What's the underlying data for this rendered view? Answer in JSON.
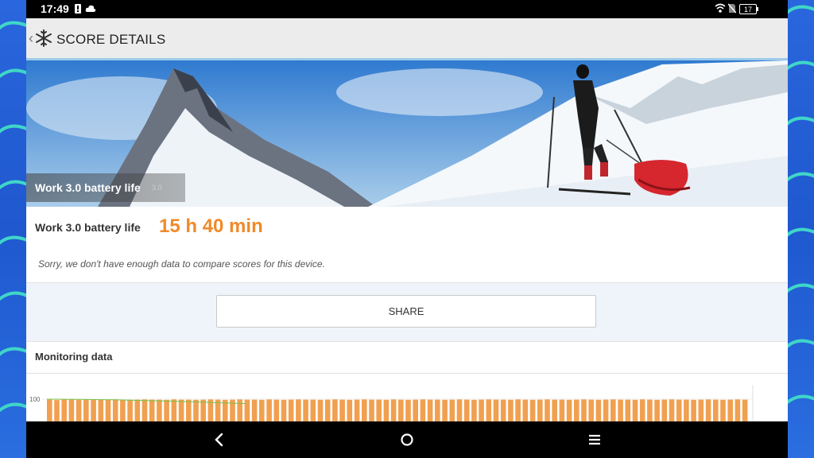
{
  "status_bar": {
    "time": "17:49",
    "battery_level": "17",
    "icons": [
      "notification-icon",
      "cloud-icon",
      "wifi-icon",
      "no-sim-icon",
      "battery-icon"
    ]
  },
  "app_bar": {
    "title": "SCORE DETAILS",
    "back_icon": "chevron-left-icon",
    "app_icon": "snowflake-icon"
  },
  "banner": {
    "caption_title": "Work 3.0 battery life",
    "caption_version": "3.0"
  },
  "score": {
    "label": "Work 3.0 battery life",
    "value": "15 h 40 min"
  },
  "notice": "Sorry, we don't have enough data to compare scores for this device.",
  "share_label": "SHARE",
  "monitoring": {
    "title": "Monitoring data",
    "y_tick": "100"
  },
  "chart_data": {
    "type": "bar",
    "y_tick_labels": [
      "100"
    ],
    "bar_series_values": [
      98,
      96,
      98,
      99,
      97,
      98,
      99,
      98,
      97,
      99,
      98,
      97,
      98,
      99,
      98,
      98,
      97,
      99,
      98,
      98,
      97,
      98,
      99,
      98,
      97,
      98,
      99,
      98,
      98,
      97,
      99,
      98,
      97,
      98,
      99,
      98,
      98,
      97,
      98,
      99,
      98,
      97,
      98,
      99,
      98,
      98,
      97,
      99,
      98,
      97,
      98,
      99,
      98,
      98,
      97,
      98,
      99,
      98,
      97,
      98,
      99,
      98,
      98,
      97,
      99,
      98,
      97,
      98,
      99,
      98,
      98,
      97,
      98,
      99,
      98,
      97,
      98,
      99,
      98,
      98,
      97,
      99,
      98,
      97,
      98,
      99,
      98,
      98,
      97,
      98,
      99,
      98,
      97,
      98,
      99,
      98
    ],
    "line_series_values": [
      100,
      99,
      97,
      94,
      90,
      85,
      80
    ],
    "colors": {
      "bars": "#f0a050",
      "line": "#7cc04a"
    }
  },
  "nav_bar": {
    "back": "nav-back-icon",
    "home": "nav-home-icon",
    "recents": "nav-menu-icon"
  }
}
